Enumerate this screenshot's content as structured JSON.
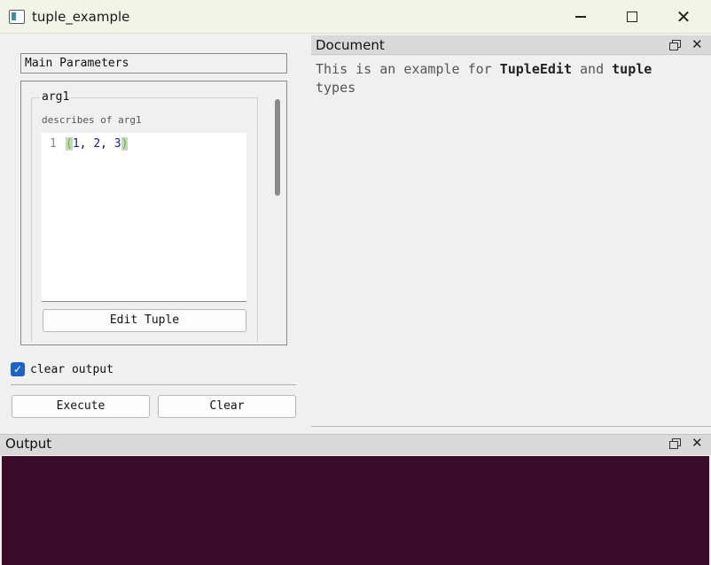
{
  "window": {
    "title": "tuple_example",
    "min_glyph": "",
    "close_glyph": "✕"
  },
  "left_panel": {
    "section_title": "Main Parameters",
    "group": {
      "title": "arg1",
      "description": "describes of arg1"
    },
    "editor": {
      "line_number": "1",
      "open_paren": "(",
      "values": [
        "1",
        "2",
        "3"
      ],
      "close_paren": ")"
    },
    "edit_button": "Edit Tuple",
    "clear_output": {
      "label": "clear output",
      "checked": true,
      "check_glyph": "✓"
    },
    "execute_button": "Execute",
    "clear_button": "Clear"
  },
  "document": {
    "title": "Document",
    "close_glyph": "✕",
    "text_1": "This is an example for ",
    "bold_1": "TupleEdit",
    "text_2": " and ",
    "bold_2": "tuple",
    "text_3": " types"
  },
  "output": {
    "title": "Output",
    "close_glyph": "✕"
  },
  "colors": {
    "output_bg": "#3b0c2a",
    "checkbox_accent": "#1a62c7",
    "paren_highlight": "#b8e0b8"
  }
}
